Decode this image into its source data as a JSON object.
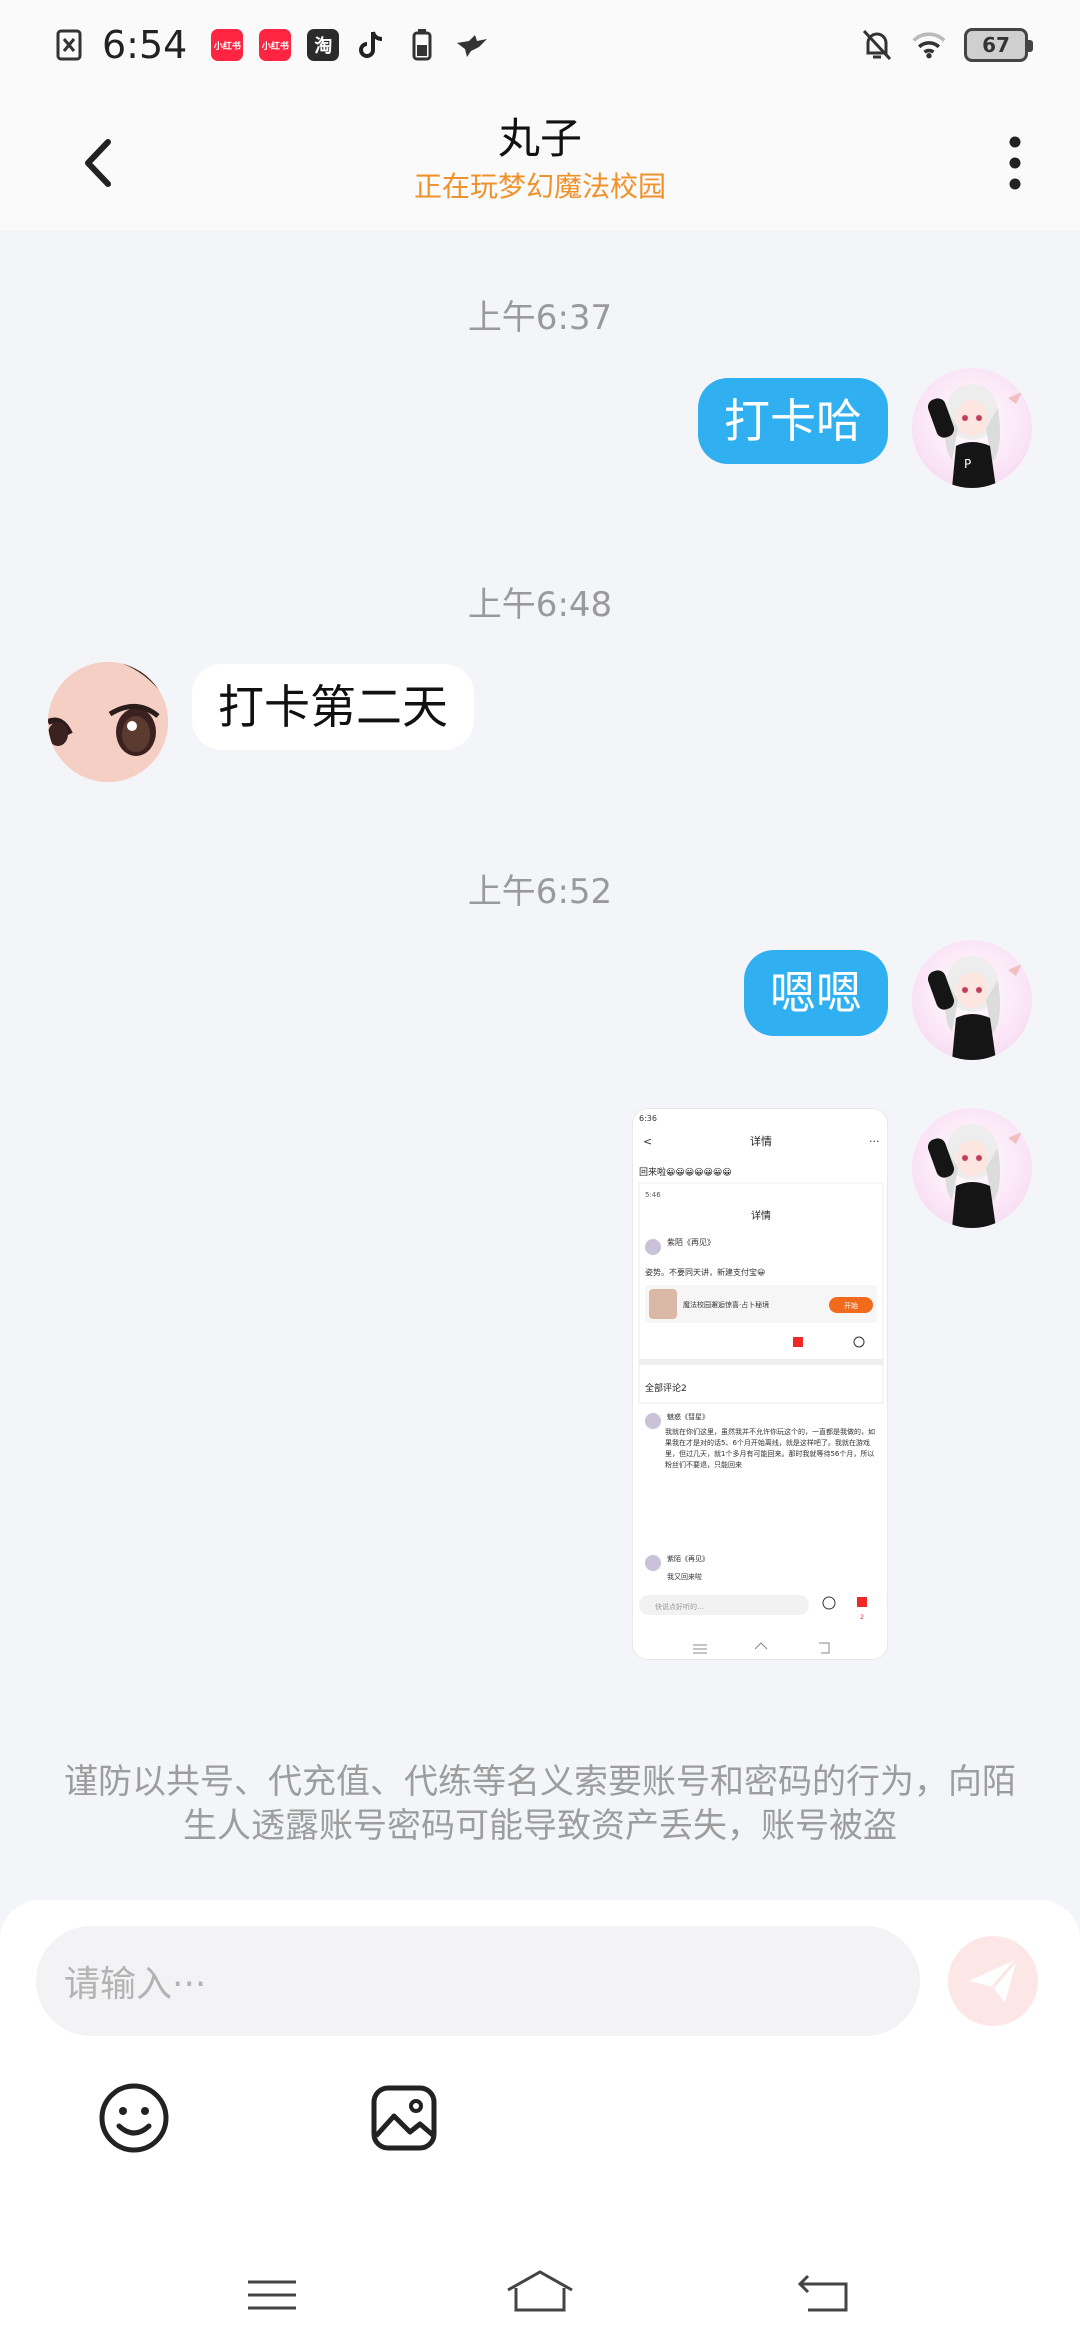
{
  "status_bar": {
    "time": "6:54",
    "app_badges": [
      "小红书",
      "小红书",
      "淘"
    ],
    "battery": "67"
  },
  "header": {
    "title": "丸子",
    "subtitle": "正在玩梦幻魔法校园"
  },
  "messages": [
    {
      "type": "time",
      "text": "上午6:37"
    },
    {
      "type": "text",
      "side": "self",
      "text": "打卡哈"
    },
    {
      "type": "time",
      "text": "上午6:48"
    },
    {
      "type": "text",
      "side": "other",
      "text": "打卡第二天"
    },
    {
      "type": "time",
      "text": "上午6:52"
    },
    {
      "type": "text",
      "side": "self",
      "text": "嗯嗯"
    },
    {
      "type": "image",
      "side": "self"
    }
  ],
  "shared_screenshot": {
    "time": "6:36",
    "title": "详情",
    "line1": "回来啦😀😀😀😀😀😀😀",
    "inner_time": "5:46",
    "inner_title": "详情",
    "post_author": "紫陌《再见》",
    "post_text": "姿势。不要同天讲，新建支付宝😀",
    "game_name": "魔法校园邂逅惊喜·占卜秘境",
    "game_btn": "开始",
    "comments_header": "全部评论2",
    "comment1_author": "魅惑《彗星》",
    "comment1_text": "我就在你们这里，虽然我并不允许你玩这个的，一直都是我做的，如果我在才是对的话5、6个月开始离线，就是这样吧了。我就在游戏里，但过几天，就1个多月有可能回来。那时我就等待56个月，所以粉丝们不要退，只能回来",
    "comment2_author": "紫陌《再见》",
    "comment2_text": "我又回来啦",
    "input_placeholder": "快说点好听的…",
    "like_count": "2"
  },
  "warning_text": "谨防以共号、代充值、代练等名义索要账号和密码的行为，向陌生人透露账号密码可能导致资产丢失，账号被盗",
  "input": {
    "placeholder": "请输入···"
  },
  "icons": {
    "back": "back-arrow-icon",
    "more": "more-vertical-icon",
    "emoji": "emoji-smile-icon",
    "image": "image-picture-icon",
    "send": "send-paper-plane-icon",
    "menu": "menu-lines-icon",
    "home": "home-icon",
    "return": "return-icon"
  },
  "colors": {
    "self_bubble": "#30b0f0",
    "subtitle": "#f0922b",
    "send_button": "#fde6e6"
  }
}
